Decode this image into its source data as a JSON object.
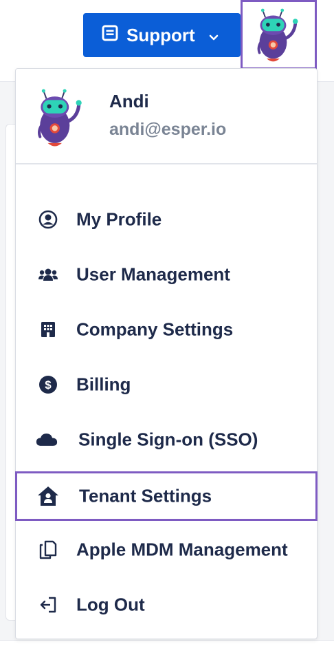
{
  "header": {
    "support_label": "Support",
    "support_icon": "receipt-icon",
    "support_chevron": "chevron-down-icon",
    "avatar_icon": "robot-avatar"
  },
  "profile": {
    "name": "Andi",
    "email": "andi@esper.io"
  },
  "menu": {
    "items": [
      {
        "label": "My Profile",
        "icon": "user-circle-icon"
      },
      {
        "label": "User Management",
        "icon": "users-icon"
      },
      {
        "label": "Company Settings",
        "icon": "building-icon"
      },
      {
        "label": "Billing",
        "icon": "dollar-circle-icon"
      },
      {
        "label": "Single Sign-on (SSO)",
        "icon": "cloud-icon"
      },
      {
        "label": "Tenant Settings",
        "icon": "house-user-icon"
      },
      {
        "label": "Apple MDM Management",
        "icon": "copy-icon"
      },
      {
        "label": "Log Out",
        "icon": "logout-icon"
      }
    ]
  },
  "colors": {
    "primary": "#0b5ed7",
    "highlight": "#7e5bc2",
    "text": "#1e2a4a",
    "muted": "#7a8494"
  }
}
